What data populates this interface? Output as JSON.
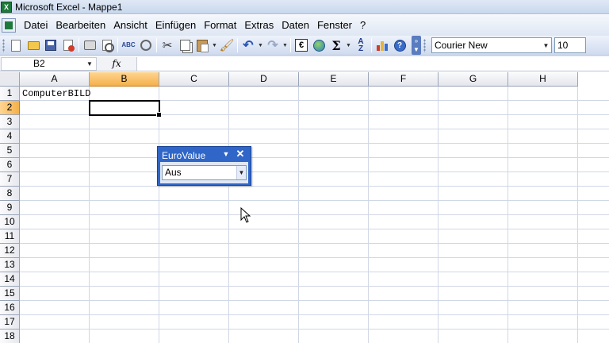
{
  "window": {
    "title": "Microsoft Excel - Mappe1",
    "app_icon": "X"
  },
  "menu": {
    "items": [
      "Datei",
      "Bearbeiten",
      "Ansicht",
      "Einfügen",
      "Format",
      "Extras",
      "Daten",
      "Fenster",
      "?"
    ]
  },
  "toolbar": {
    "icons": [
      "new-icon",
      "open-icon",
      "save-icon",
      "permission-icon",
      "print-icon",
      "print-preview-icon",
      "spelling-icon",
      "research-icon",
      "cut-icon",
      "copy-icon",
      "paste-icon",
      "format-painter-icon",
      "undo-icon",
      "redo-icon",
      "euro-conversion-icon",
      "hyperlink-icon",
      "autosum-icon",
      "sort-ascending-icon",
      "chart-wizard-icon",
      "help-icon"
    ],
    "spelling_glyph": "ABC",
    "autosum_glyph": "Σ",
    "sort_glyph_top": "A",
    "sort_glyph_bottom": "Z",
    "euro_glyph": "€",
    "help_glyph": "?",
    "font_name": "Courier New",
    "font_size": "10"
  },
  "formula_bar": {
    "name_box": "B2",
    "fx_label": "fx",
    "formula": ""
  },
  "sheet": {
    "columns": [
      "A",
      "B",
      "C",
      "D",
      "E",
      "F",
      "G",
      "H"
    ],
    "rows": [
      "1",
      "2",
      "3",
      "4",
      "5",
      "6",
      "7",
      "8",
      "9",
      "10",
      "11",
      "12",
      "13",
      "14",
      "15",
      "16",
      "17",
      "18"
    ],
    "active_cell": "B2",
    "active_column": "B",
    "active_row": "2",
    "cell_A1": "ComputerBILD"
  },
  "floating_toolbar": {
    "title": "EuroValue",
    "selected_value": "Aus"
  },
  "colors": {
    "title_bar": "#c9d8ee",
    "toolbar": "#dfe7f4",
    "active_header": "#f4b04a",
    "gridline": "#d0d7e5",
    "floating_toolbar": "#2f66c8"
  }
}
